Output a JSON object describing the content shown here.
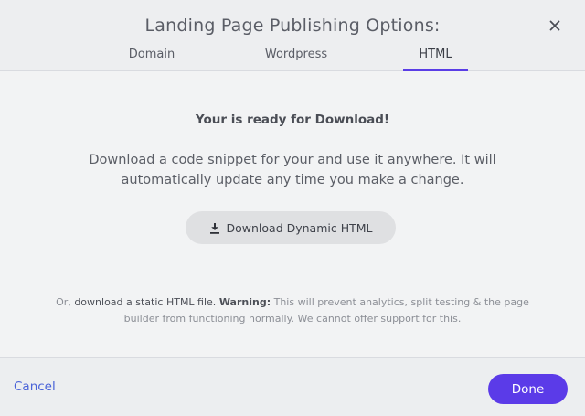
{
  "modal": {
    "title": "Landing Page Publishing Options:"
  },
  "tabs": [
    {
      "label": "Domain",
      "active": false
    },
    {
      "label": "Wordpress",
      "active": false
    },
    {
      "label": "HTML",
      "active": true
    }
  ],
  "content": {
    "heading": "Your is ready for Download!",
    "description": "Download a code snippet for your and use it anywhere. It will automatically update any time you make a change.",
    "download_button_label": "Download Dynamic HTML",
    "warning": {
      "prefix": "Or, ",
      "link_text": "download a static HTML file.",
      "bold_label": "Warning:",
      "text": " This will prevent analytics, split testing & the page builder from functioning normally. We cannot offer support for this."
    }
  },
  "footer": {
    "cancel_label": "Cancel",
    "done_label": "Done"
  },
  "colors": {
    "accent": "#5b3be8",
    "link": "#4a63d8"
  },
  "icons": {
    "close": "close-icon",
    "download": "download-icon"
  }
}
